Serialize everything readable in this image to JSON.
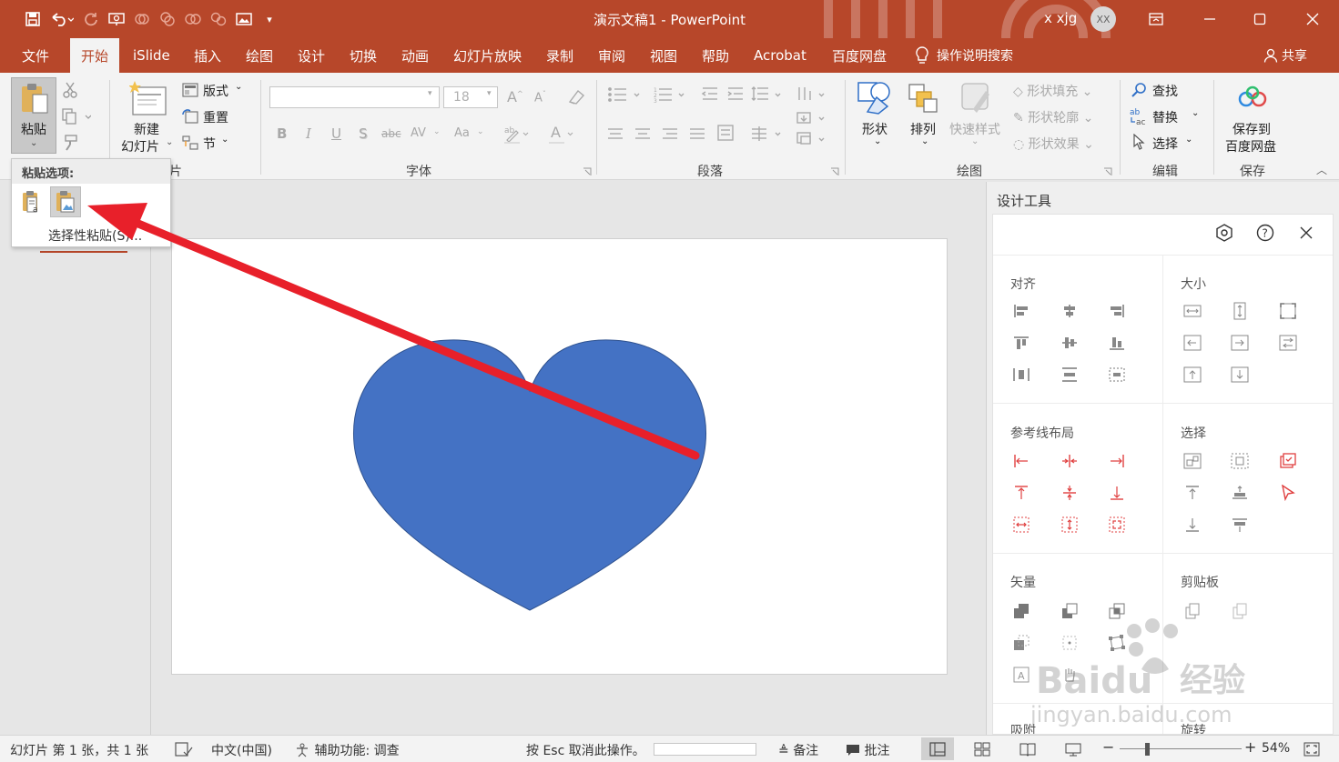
{
  "app": {
    "document_title": "演示文稿1  -  PowerPoint",
    "user_name": "x xjg",
    "avatar_initials": "XX",
    "brand_color": "#b7472a"
  },
  "qat_icons": [
    "save-icon",
    "undo-icon",
    "redo-icon",
    "slideshow-icon",
    "shape-icon",
    "picture-icon",
    "customize-icon"
  ],
  "menu": {
    "tabs": [
      "文件",
      "开始",
      "iSlide",
      "插入",
      "绘图",
      "设计",
      "切换",
      "动画",
      "幻灯片放映",
      "录制",
      "审阅",
      "视图",
      "帮助",
      "Acrobat",
      "百度网盘"
    ],
    "active_tab": "开始",
    "tell_me": "操作说明搜索",
    "share": "共享"
  },
  "ribbon": {
    "clipboard": {
      "paste": "粘贴"
    },
    "slides": {
      "new_slide_line1": "新建",
      "new_slide_line2": "幻灯片",
      "layout": "版式",
      "reset": "重置",
      "section": "节",
      "group_label_partial": "幻灯片"
    },
    "font": {
      "font_name_value": "",
      "font_size_value": "18",
      "buttons": [
        "B",
        "I",
        "U",
        "S",
        "abc",
        "AV",
        "Aa"
      ],
      "group_label": "字体"
    },
    "paragraph": {
      "group_label": "段落"
    },
    "drawing": {
      "shape": "形状",
      "arrange": "排列",
      "quick_styles": "快速样式",
      "shape_fill": "形状填充",
      "shape_outline": "形状轮廓",
      "shape_effects": "形状效果",
      "group_label": "绘图"
    },
    "editing": {
      "find": "查找",
      "replace": "替换",
      "select": "选择",
      "group_label": "编辑"
    },
    "save": {
      "line1": "保存到",
      "line2": "百度网盘",
      "group_label": "保存"
    }
  },
  "paste_popup": {
    "title": "粘贴选项:",
    "options": [
      "keep-text-only-icon",
      "paste-as-picture-icon"
    ],
    "paste_special": "选择性粘贴(S)..."
  },
  "slide": {
    "shape": "heart",
    "shape_fill": "#4472c4",
    "annotation_arrow_color": "#e8202a"
  },
  "design_panel": {
    "title": "设计工具",
    "sections": {
      "align": "对齐",
      "size": "大小",
      "guides": "参考线布局",
      "select": "选择",
      "vector": "矢量",
      "clipboard": "剪贴板",
      "partial_left": "吸附",
      "partial_right": "旋转"
    }
  },
  "status": {
    "slide_info": "幻灯片 第 1 张，共 1 张",
    "language": "中文(中国)",
    "accessibility": "辅助功能: 调查",
    "cancel_hint": "按 Esc 取消此操作。",
    "notes": "备注",
    "comments": "批注",
    "zoom": "54%",
    "zoom_fraction": 0.21
  },
  "watermark": {
    "brand": "Baidu",
    "cn": "经验",
    "url": "jingyan.baidu.com"
  }
}
